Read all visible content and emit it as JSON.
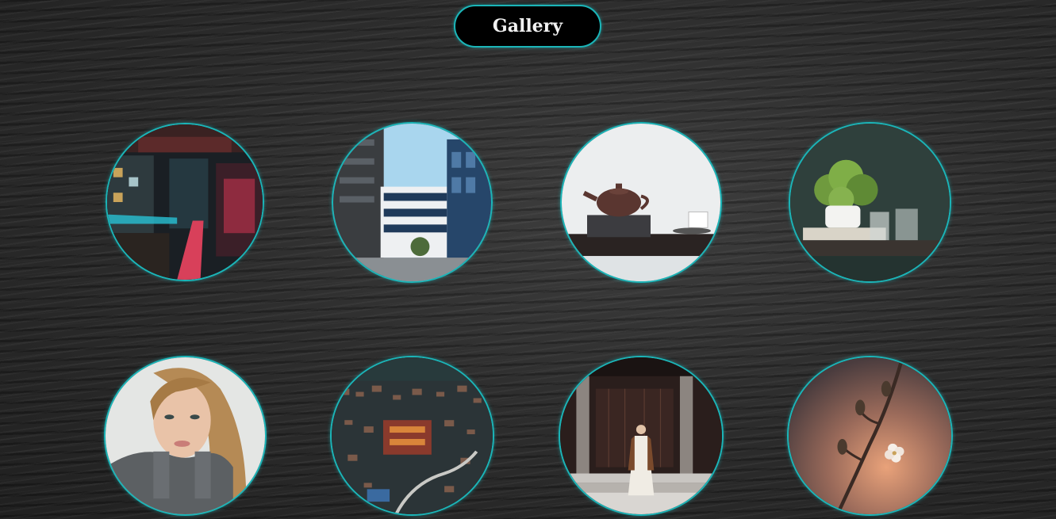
{
  "header": {
    "title": "Gallery"
  },
  "gallery": {
    "items": [
      {
        "icon": "night-city-photo"
      },
      {
        "icon": "office-buildings-photo"
      },
      {
        "icon": "teapot-photo"
      },
      {
        "icon": "potted-plant-photo"
      },
      {
        "icon": "woman-portrait-photo"
      },
      {
        "icon": "aerial-town-photo"
      },
      {
        "icon": "temple-woman-photo"
      },
      {
        "icon": "blossom-branch-photo"
      }
    ]
  },
  "colors": {
    "accent": "#1bb5b8",
    "pill_background": "#000000",
    "page_background": "#2a2a2a"
  }
}
